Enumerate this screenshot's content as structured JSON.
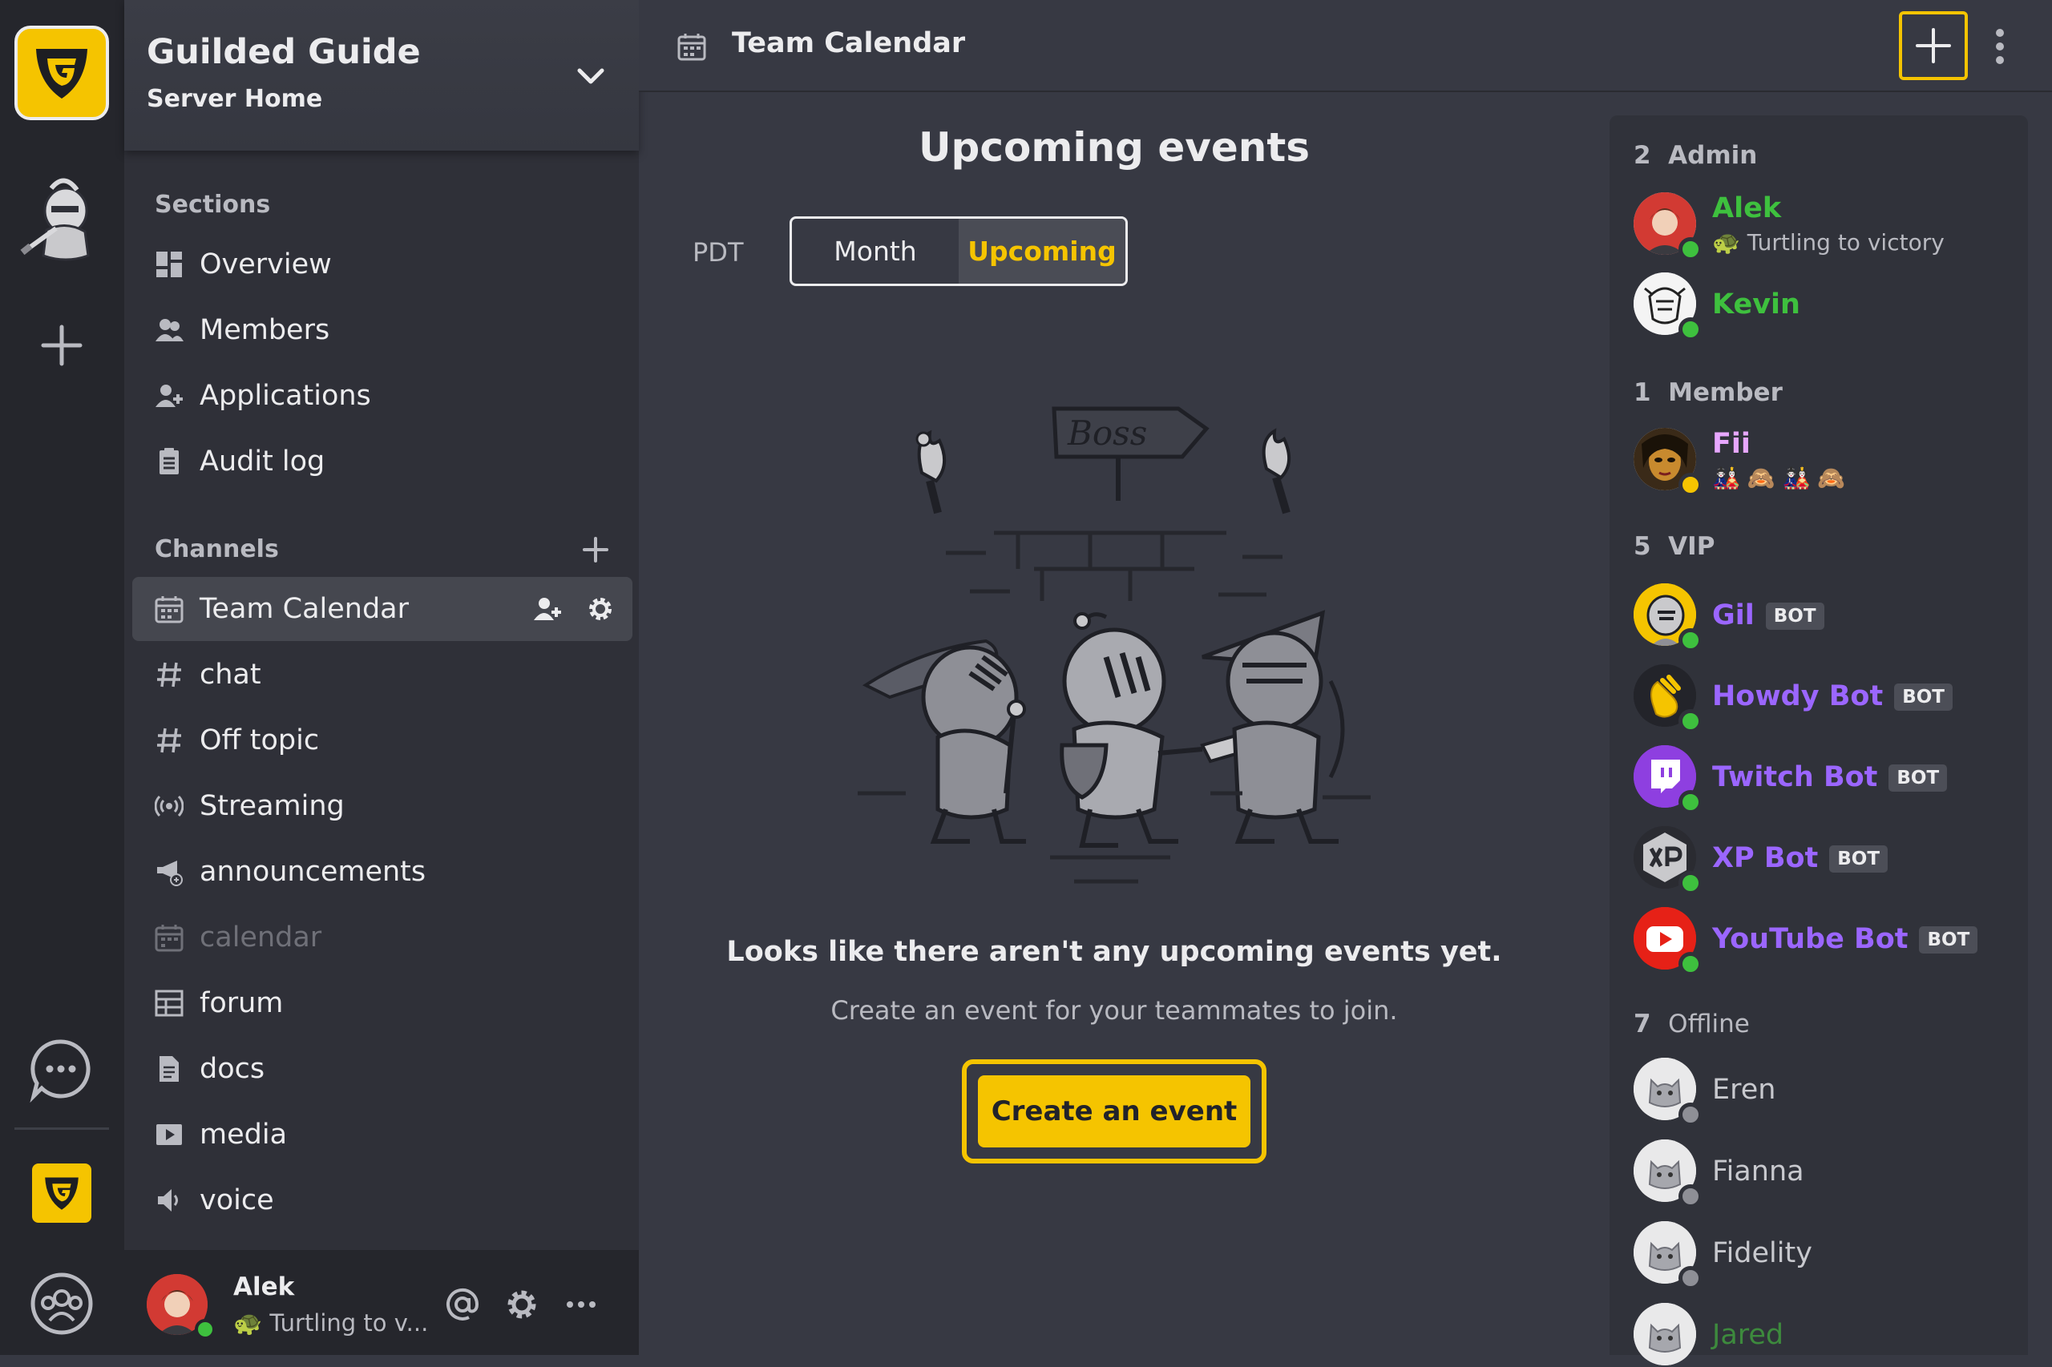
{
  "colors": {
    "accent": "#f5c400",
    "online": "#3ec03e",
    "away": "#f5c400",
    "admin_name": "#3ec03e",
    "member_name": "#e7a7ff",
    "bot_name": "#9b66ff",
    "offline_name": "#c8c9ce"
  },
  "server": {
    "name": "Guilded Guide",
    "subtitle": "Server Home"
  },
  "sidebar": {
    "sections_heading": "Sections",
    "sections": [
      {
        "label": "Overview",
        "icon": "overview-icon"
      },
      {
        "label": "Members",
        "icon": "members-icon"
      },
      {
        "label": "Applications",
        "icon": "applications-icon"
      },
      {
        "label": "Audit log",
        "icon": "audit-log-icon"
      }
    ],
    "channels_heading": "Channels",
    "channels": [
      {
        "label": "Team Calendar",
        "icon": "calendar-icon",
        "active": true
      },
      {
        "label": "chat",
        "icon": "hash-icon"
      },
      {
        "label": "Off topic",
        "icon": "hash-icon"
      },
      {
        "label": "Streaming",
        "icon": "stream-icon"
      },
      {
        "label": "announcements",
        "icon": "megaphone-icon"
      },
      {
        "label": "calendar",
        "icon": "calendar-icon",
        "muted": true
      },
      {
        "label": "forum",
        "icon": "forum-icon"
      },
      {
        "label": "docs",
        "icon": "docs-icon"
      },
      {
        "label": "media",
        "icon": "media-icon"
      },
      {
        "label": "voice",
        "icon": "voice-icon"
      }
    ]
  },
  "user": {
    "name": "Alek",
    "status": "🐢 Turtling to v..."
  },
  "header": {
    "title": "Team Calendar"
  },
  "events": {
    "title": "Upcoming events",
    "timezone": "PDT",
    "view_options": [
      "Month",
      "Upcoming"
    ],
    "selected_view": "Upcoming",
    "illustration_sign": "Boss",
    "empty_title": "Looks like there aren't any upcoming events yet.",
    "empty_subtitle": "Create an event for your teammates to join.",
    "create_label": "Create an event"
  },
  "members": {
    "groups": [
      {
        "count": "2",
        "label": "Admin"
      },
      {
        "count": "1",
        "label": "Member"
      },
      {
        "count": "5",
        "label": "VIP"
      },
      {
        "count": "7",
        "label": "Offline"
      }
    ],
    "admin": [
      {
        "name": "Alek",
        "status": "🐢 Turtling to victory"
      },
      {
        "name": "Kevin"
      }
    ],
    "member": [
      {
        "name": "Fii",
        "status": "🎎 🙈 🎎 🙈"
      }
    ],
    "vip": [
      {
        "name": "Gil",
        "badge": "BOT"
      },
      {
        "name": "Howdy Bot",
        "badge": "BOT"
      },
      {
        "name": "Twitch Bot",
        "badge": "BOT"
      },
      {
        "name": "XP Bot",
        "badge": "BOT"
      },
      {
        "name": "YouTube Bot",
        "badge": "BOT"
      }
    ],
    "offline": [
      {
        "name": "Eren"
      },
      {
        "name": "Fianna"
      },
      {
        "name": "Fidelity"
      },
      {
        "name": "Jared"
      }
    ]
  }
}
